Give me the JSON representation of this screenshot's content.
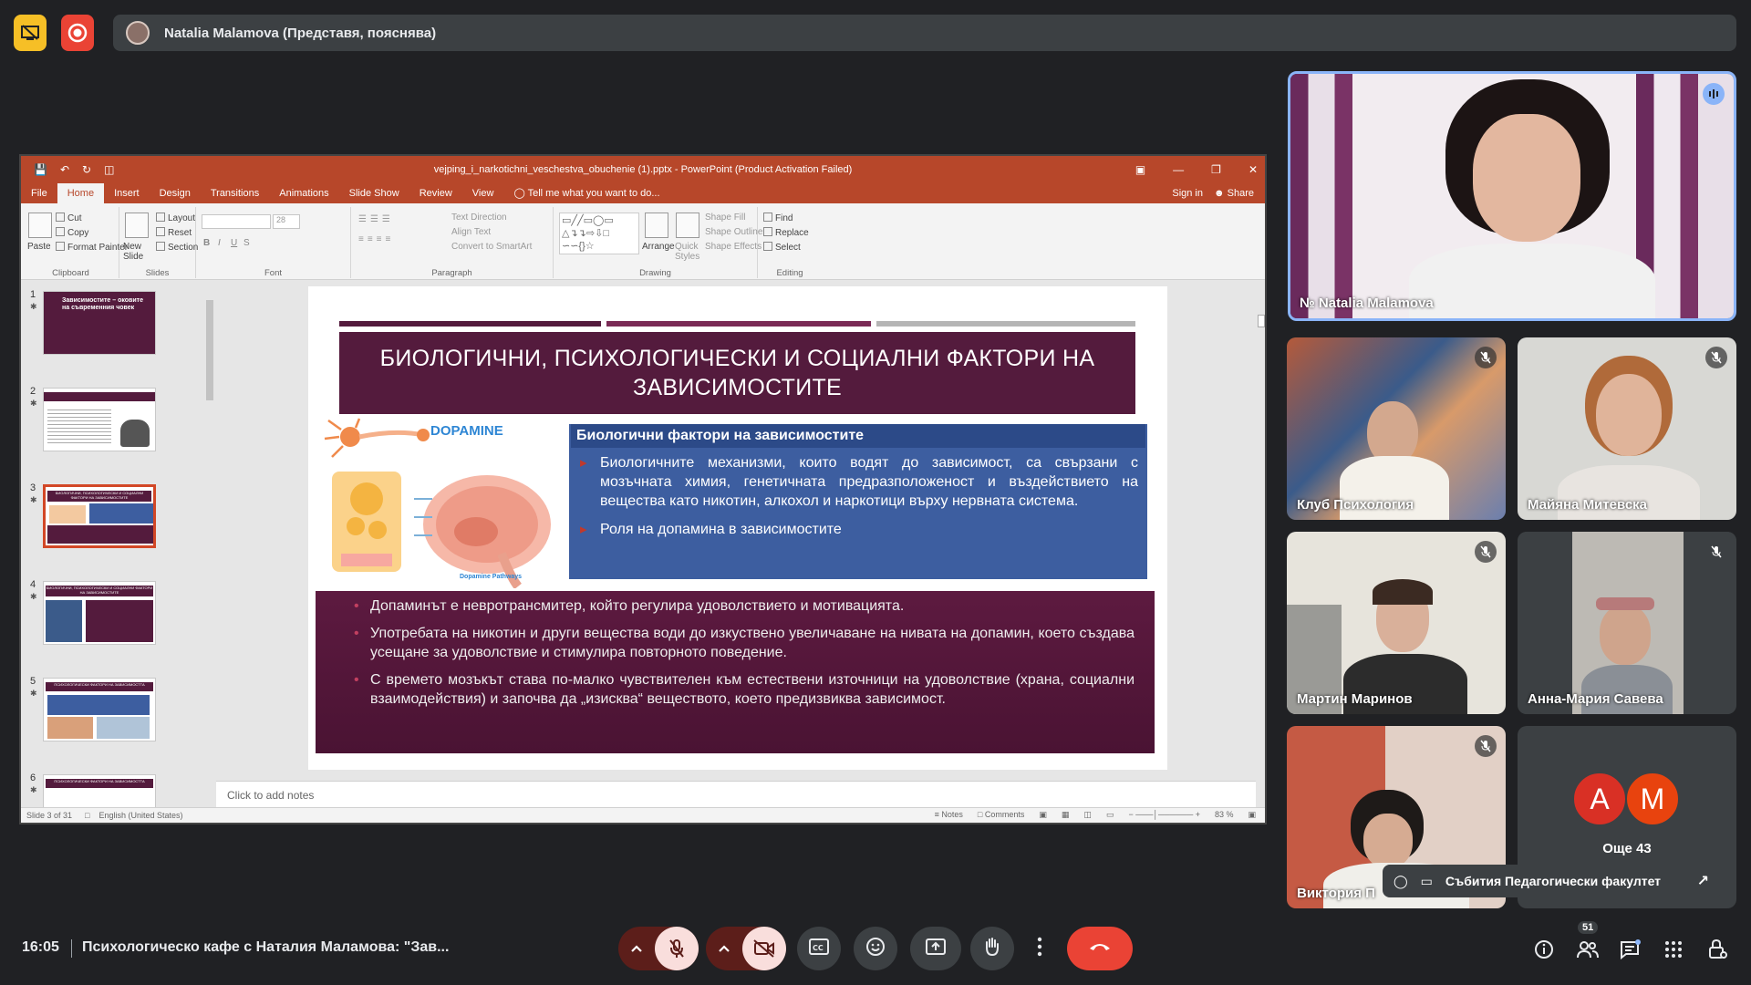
{
  "meet": {
    "presenter_banner": "Natalia Malamova (Представя, пояснява)",
    "clock": "16:05",
    "meeting_title": "Психологическо кафе с Наталия Маламова: \"Зав...",
    "participant_count": "51",
    "others_label": "Още 43",
    "others_avatars": [
      "A",
      "M"
    ],
    "pip_label": "Събития Педагогически факултет",
    "accent_color": "#8ab4f8",
    "hangup_color": "#ea4335"
  },
  "participants": [
    {
      "name": "Natalia Malamova"
    },
    {
      "name": "Клуб Психология"
    },
    {
      "name": "Майяна Митевска"
    },
    {
      "name": "Мартин Маринов"
    },
    {
      "name": "Анна-Мария Савева"
    },
    {
      "name": "Виктория П"
    }
  ],
  "ppt": {
    "filename": "vejping_i_narkotichni_veschestva_obuchenie (1).pptx - PowerPoint (Product Activation Failed)",
    "tabs": [
      "File",
      "Home",
      "Insert",
      "Design",
      "Transitions",
      "Animations",
      "Slide Show",
      "Review",
      "View"
    ],
    "tell_me": "Tell me what you want to do...",
    "sign_in": "Sign in",
    "share": "Share",
    "ribbon": {
      "clipboard": "Clipboard",
      "slides": "Slides",
      "font": "Font",
      "paragraph": "Paragraph",
      "drawing": "Drawing",
      "editing": "Editing",
      "paste": "Paste",
      "cut": "Cut",
      "copy": "Copy",
      "format_painter": "Format Painter",
      "new_slide": "New Slide",
      "layout": "Layout",
      "reset": "Reset",
      "section": "Section",
      "font_size": "28",
      "text_direction": "Text Direction",
      "align_text": "Align Text",
      "convert_smartart": "Convert to SmartArt",
      "arrange": "Arrange",
      "quick_styles": "Quick Styles",
      "shape_fill": "Shape Fill",
      "shape_outline": "Shape Outline",
      "shape_effects": "Shape Effects",
      "find": "Find",
      "replace": "Replace",
      "select": "Select"
    },
    "slide_numbers": [
      "1",
      "2",
      "3",
      "4",
      "5",
      "6"
    ],
    "thumb_titles": [
      "Зависимостите – оковите на съвременния човек",
      "",
      "БИОЛОГИЧНИ, ПСИХОЛОГИЧЕСКИ И СОЦИАЛНИ ФАКТОРИ НА ЗАВИСИМОСТИТЕ",
      "БИОЛОГИЧНИ, ПСИХОЛОГИЧЕСКИ И СОЦИАЛНИ ФАКТОРИ НА ЗАВИСИМОСТИТЕ",
      "ПСИХОЛОГИЧЕСКИ ФАКТОРИ НА ЗАВИСИМОСТТА",
      "ПСИХОЛОГИЧЕСКИ ФАКТОРИ НА ЗАВИСИМОСТТА"
    ],
    "notes_placeholder": "Click to add notes",
    "status_slide": "Slide 3 of 31",
    "status_lang": "English (United States)",
    "status_notes": "Notes",
    "status_comments": "Comments",
    "zoom": "83 %"
  },
  "slide": {
    "title": "БИОЛОГИЧНИ, ПСИХОЛОГИЧЕСКИ И СОЦИАЛНИ ФАКТОРИ НА ЗАВИСИМОСТИТЕ",
    "dopamine_label": "DOPAMINE",
    "dopamine_caption": "Dopamine Pathways",
    "bio_heading": "Биологични фактори на зависимостите",
    "bio_bullets": [
      "Биологичните механизми, които водят до зависимост, са свързани с мозъчната химия, генетичната предразположеност и въздействието на вещества като никотин, алкохол и наркотици върху нервната система.",
      "Роля на допамина в зависимостите"
    ],
    "lower_bullets": [
      "Допаминът е невротрансмитер, който регулира удоволствието и мотивацията.",
      "Употребата на никотин и други вещества води до изкуствено увеличаване на нивата на допамин, което създава усещане за удоволствие и стимулира повторното поведение.",
      "С времето мозъкът става по-малко чувствителен към естествени източници на удоволствие (храна, социални взаимодействия) и започва да „изисква“ веществото, което предизвиква зависимост."
    ],
    "title_color": "#541b3d",
    "bio_color": "#3d5ea0"
  }
}
